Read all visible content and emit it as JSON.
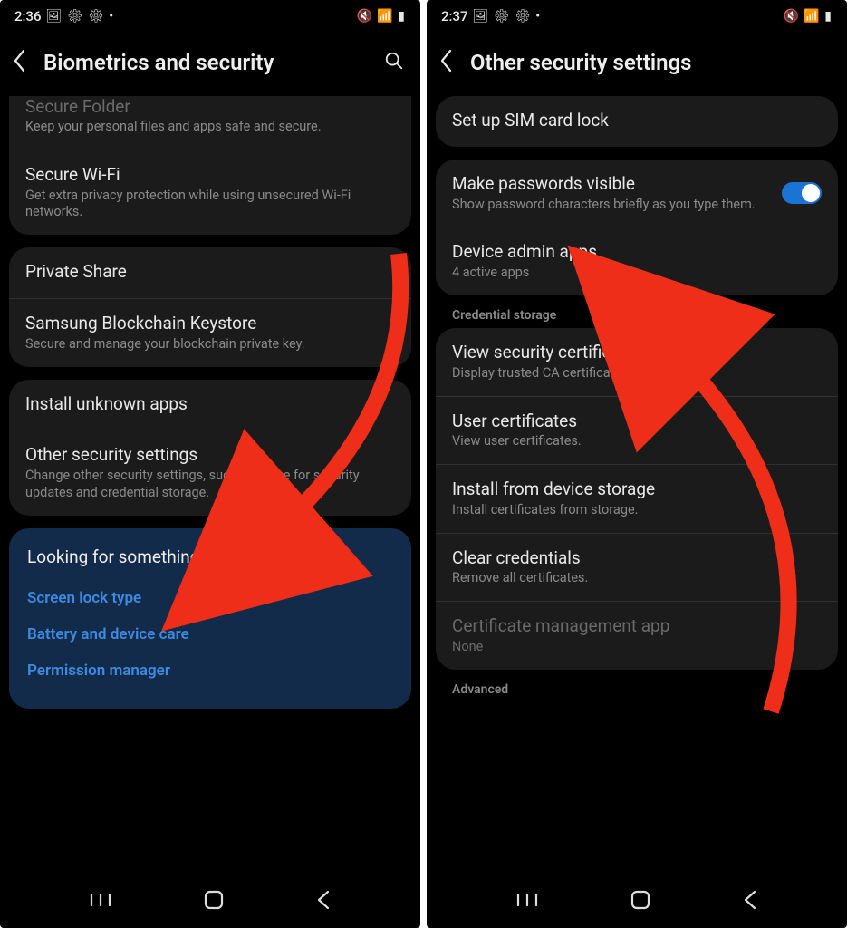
{
  "left": {
    "status_time": "2:36",
    "title": "Biometrics and security",
    "secure_folder": {
      "title": "Secure Folder",
      "sub": "Keep your personal files and apps safe and secure."
    },
    "secure_wifi": {
      "title": "Secure Wi-Fi",
      "sub": "Get extra privacy protection while using unsecured Wi-Fi networks."
    },
    "private_share": {
      "title": "Private Share"
    },
    "blockchain": {
      "title": "Samsung Blockchain Keystore",
      "sub": "Secure and manage your blockchain private key."
    },
    "install_unknown": {
      "title": "Install unknown apps"
    },
    "other_security": {
      "title": "Other security settings",
      "sub": "Change other security settings, such as those for security updates and credential storage."
    },
    "suggest": {
      "heading": "Looking for something else?",
      "links": [
        "Screen lock type",
        "Battery and device care",
        "Permission manager"
      ]
    }
  },
  "right": {
    "status_time": "2:37",
    "title": "Other security settings",
    "sim_lock": {
      "title": "Set up SIM card lock"
    },
    "passwords_visible": {
      "title": "Make passwords visible",
      "sub": "Show password characters briefly as you type them."
    },
    "device_admin": {
      "title": "Device admin apps",
      "sub": "4 active apps"
    },
    "sec_credential": "Credential storage",
    "view_certs": {
      "title": "View security certificates",
      "sub": "Display trusted CA certificates."
    },
    "user_certs": {
      "title": "User certificates",
      "sub": "View user certificates."
    },
    "install_storage": {
      "title": "Install from device storage",
      "sub": "Install certificates from storage."
    },
    "clear_creds": {
      "title": "Clear credentials",
      "sub": "Remove all certificates."
    },
    "cert_mgmt": {
      "title": "Certificate management app",
      "sub": "None"
    },
    "sec_advanced": "Advanced"
  }
}
